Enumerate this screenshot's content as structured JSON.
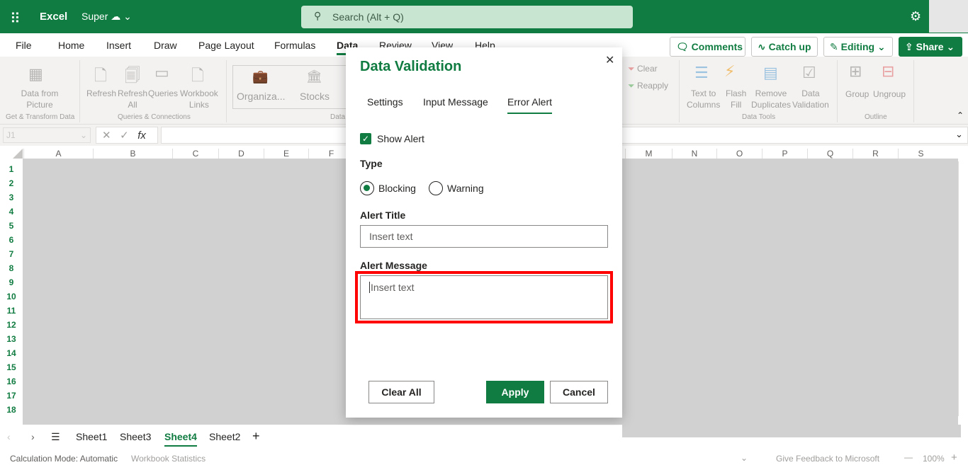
{
  "topbar": {
    "waffle_icon": "app-launcher-icon",
    "app": "Excel",
    "workbook": "Super",
    "search_placeholder": "Search (Alt + Q)",
    "settings_icon": "gear-icon"
  },
  "menu_tabs": [
    "File",
    "Home",
    "Insert",
    "Draw",
    "Page Layout",
    "Formulas",
    "Data",
    "Review",
    "View",
    "Help"
  ],
  "active_tab": "Data",
  "header_buttons": {
    "comments": "Comments",
    "catch_up": "Catch up",
    "editing": "Editing",
    "share": "Share"
  },
  "ribbon": {
    "data_from_picture": [
      "Data from",
      "Picture"
    ],
    "refresh": "Refresh",
    "refresh_all": [
      "Refresh",
      "All"
    ],
    "queries": "Queries",
    "workbook_links": [
      "Workbook",
      "Links"
    ],
    "organization": "Organiza...",
    "stocks": "Stocks",
    "clear": "Clear",
    "reapply": "Reapply",
    "text_to_columns": [
      "Text to",
      "Columns"
    ],
    "flash_fill": [
      "Flash",
      "Fill"
    ],
    "remove_duplicates": [
      "Remove",
      "Duplicates"
    ],
    "data_validation": [
      "Data",
      "Validation"
    ],
    "group": "Group",
    "ungroup": "Ungroup",
    "groups": {
      "get_transform": "Get & Transform Data",
      "queries_connections": "Queries & Connections",
      "data_types": "Data",
      "data_tools": "Data Tools",
      "outline": "Outline"
    }
  },
  "formula_bar": {
    "name_box": "J1",
    "fx": "fx",
    "value": ""
  },
  "columns_left": [
    "A",
    "B",
    "C",
    "D",
    "E",
    "F"
  ],
  "columns_right": [
    "M",
    "N",
    "O",
    "P",
    "Q",
    "R",
    "S"
  ],
  "rows": [
    "1",
    "2",
    "3",
    "4",
    "5",
    "6",
    "7",
    "8",
    "9",
    "10",
    "11",
    "12",
    "13",
    "14",
    "15",
    "16",
    "17",
    "18"
  ],
  "dialog": {
    "title": "Data Validation",
    "tabs": [
      "Settings",
      "Input Message",
      "Error Alert"
    ],
    "active_tab": "Error Alert",
    "show_alert_label": "Show Alert",
    "show_alert_checked": true,
    "type_label": "Type",
    "type_options": [
      "Blocking",
      "Warning"
    ],
    "type_selected": "Blocking",
    "alert_title_label": "Alert Title",
    "alert_title_placeholder": "Insert text",
    "alert_title_value": "",
    "alert_message_label": "Alert Message",
    "alert_message_placeholder": "Insert text",
    "alert_message_value": "",
    "clear_all": "Clear All",
    "apply": "Apply",
    "cancel": "Cancel",
    "highlight_color": "#ff0000"
  },
  "sheets": [
    "Sheet1",
    "Sheet3",
    "Sheet4",
    "Sheet2"
  ],
  "active_sheet": "Sheet4",
  "status": {
    "calc_mode": "Calculation Mode: Automatic",
    "workbook_stats": "Workbook Statistics",
    "feedback": "Give Feedback to Microsoft",
    "zoom": "100%"
  },
  "colors": {
    "brand": "#107c41",
    "overlay": "#d1d1d1"
  }
}
